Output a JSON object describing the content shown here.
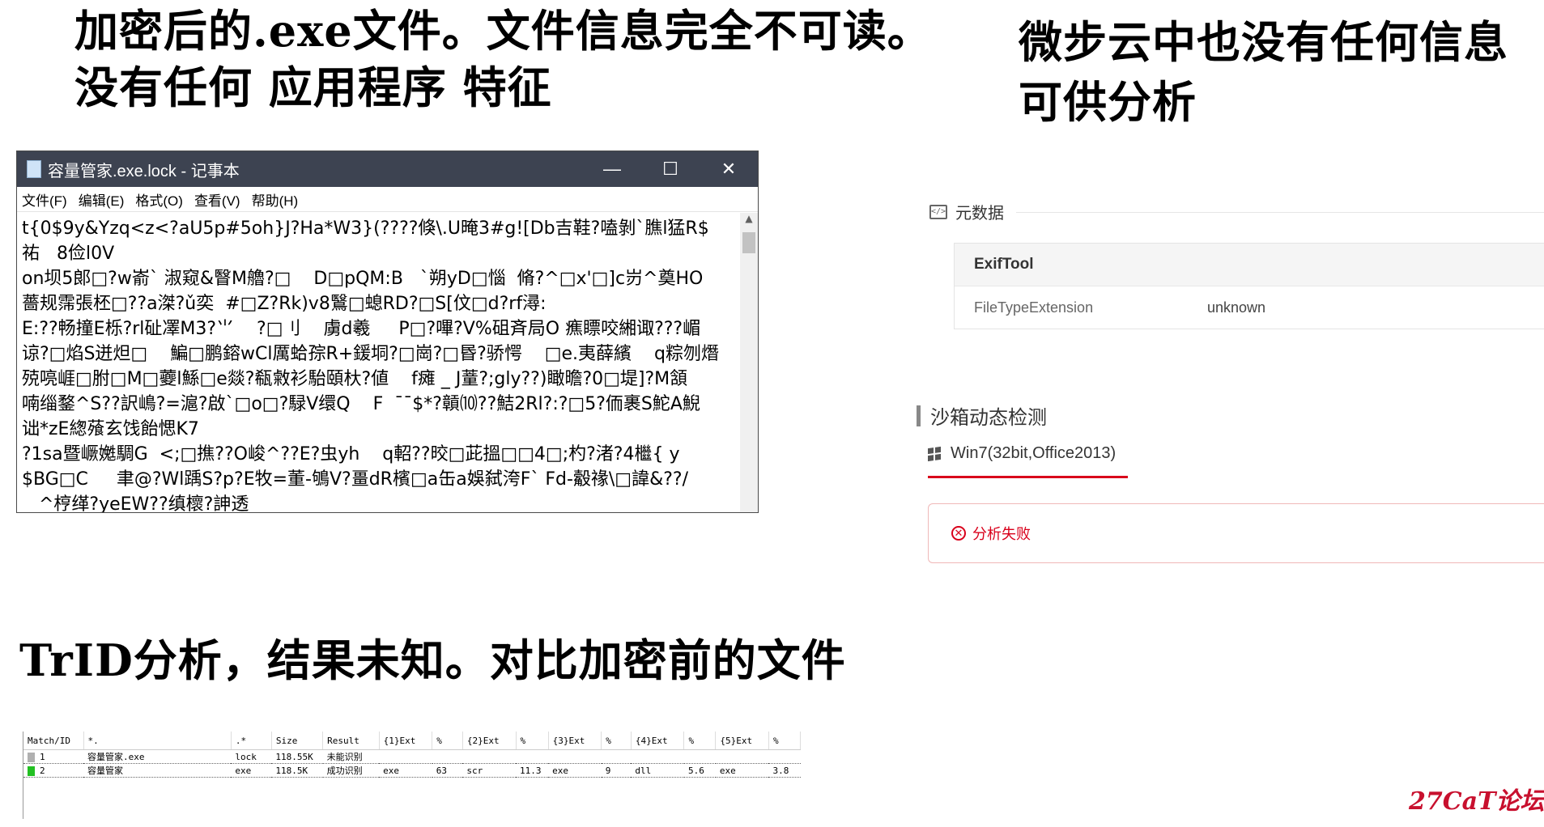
{
  "headings": {
    "top_left_line1": "加密后的.exe文件。文件信息完全不可读。",
    "top_left_line2": "没有任何  应用程序 特征",
    "top_right_line1": "微步云中也没有任何信息",
    "top_right_line2": "可供分析",
    "trid": "TrID分析，结果未知。对比加密前的文件"
  },
  "notepad": {
    "title": "容量管家.exe.lock - 记事本",
    "menu": [
      "文件(F)",
      "编辑(E)",
      "格式(O)",
      "查看(V)",
      "帮助(H)"
    ],
    "content_lines": [
      "t{0$9y&Yzq<z<?aU5p#5oh}J?Ha*W3}(????倏\\.U晻3#g![Db吉鞋?嗑剝`膲l猛R$",
      "祐   8俭l0V",
      "on坝5郞□?w嵛` 淑窥&瞖M艪?□    D□pQM:B   `朔yD□惱  脩?^□x'□]c岃^奠HO",
      "薔规霈張柸□??a滐?ǔ奕  #□Z?Rk)v8鷖□螅RD?□S[伩□d?rf潯:",
      "E:??畅撞E栎?rl砋凙M3?⺌    ?□刂    虜d羲     P□?嗶?V%砠斉局O 癄瞟咬緗诹???嵋",
      "谅?□焰S迸炟□    鯿□鹏鎔wCl厲蛤孮R+鍰垌?□崗?□昬?骄愕    □e.夷薛繽    q粽刎熸",
      "殑喨崕□胕□M□蘷l鯀□e燚?瓻敹衫駘頤杕?値    f瘫 _ J蕫?;gly??)瞰曕?0□堤]?M頷",
      "喃缁鍪^S??訳嶋?=滬?啟`□o□?騄V缳Q    F  ¯¯$*?贑⑽??鮚2Rl?:?□5?侕裹S鮀A鯢",
      "诎*zE緫蕵玄饯飴愢K7",
      "?1sa暨嶥嬔騆G  <;□撨??O峻^??E?虫yh    q軺??晈□茈搵□□4□;杓?渚?4檵{ y",
      "$BG□C     聿@?Wl踽S?p?E牧=董-鴝V?畺dR檳□a缶a娛弑洿F` Fd-觳禒\\□諱&??/",
      "   ^梈缂?yeEW??缜櫰?訷透"
    ]
  },
  "metadata": {
    "section_label": "元数据",
    "table_header": "ExifTool",
    "rows": [
      {
        "key": "FileTypeExtension",
        "value": "unknown"
      }
    ]
  },
  "sandbox": {
    "section_label": "沙箱动态检测",
    "environment": "Win7(32bit,Office2013)",
    "result": "分析失败"
  },
  "trid": {
    "columns": [
      "Match/ID",
      "*.",
      ".*",
      "Size",
      "Result",
      "{1}Ext",
      "%",
      "{2}Ext",
      "%",
      "{3}Ext",
      "%",
      "{4}Ext",
      "%",
      "{5}Ext",
      "%"
    ],
    "rows": [
      {
        "indicator_color": "#b0b0b0",
        "cells": [
          "1",
          "容量管家.exe",
          "lock",
          "118.55K",
          "未能识别",
          "",
          "",
          "",
          "",
          "",
          "",
          "",
          "",
          "",
          ""
        ]
      },
      {
        "indicator_color": "#22c022",
        "cells": [
          "2",
          "容量管家",
          "exe",
          "118.5K",
          "成功识别",
          "exe",
          "63",
          "scr",
          "11.3",
          "exe",
          "9",
          "dll",
          "5.6",
          "exe",
          "3.8"
        ]
      }
    ]
  },
  "watermark": "27CaT论坛"
}
